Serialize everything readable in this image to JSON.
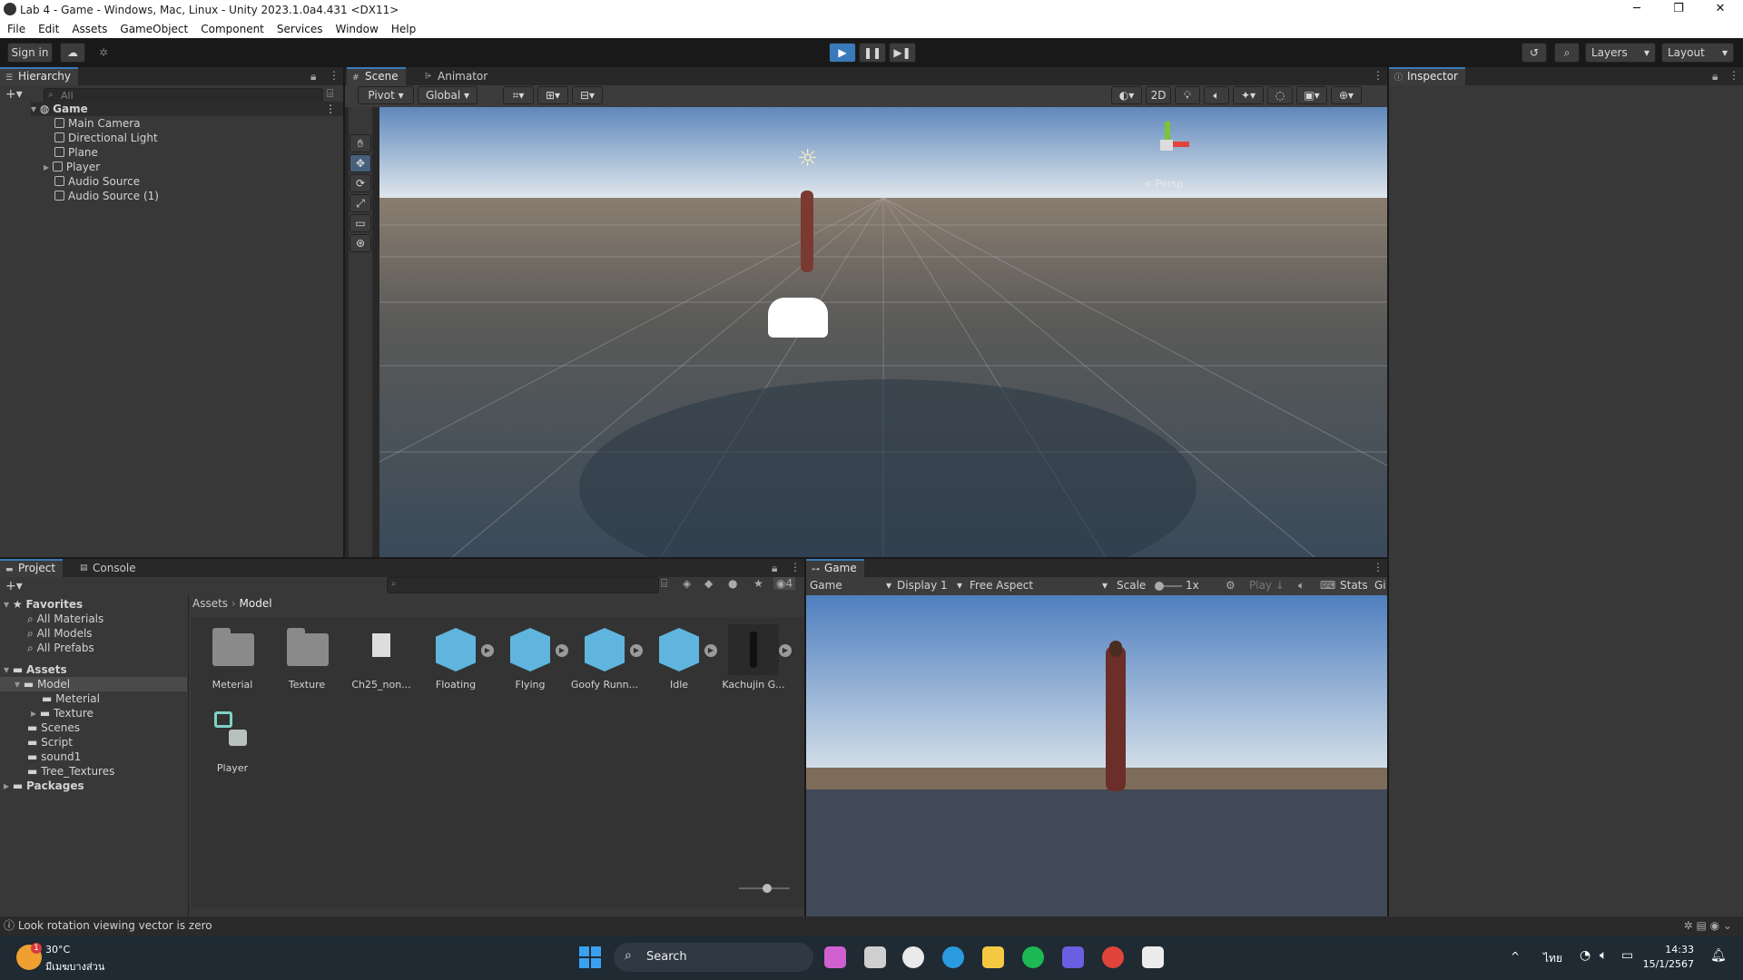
{
  "window": {
    "title": "Lab 4 - Game - Windows, Mac, Linux - Unity 2023.1.0a4.431 <DX11>",
    "controls": [
      "─",
      "❐",
      "✕"
    ]
  },
  "menu": [
    "File",
    "Edit",
    "Assets",
    "GameObject",
    "Component",
    "Services",
    "Window",
    "Help"
  ],
  "toolbar": {
    "sign_in": "Sign in",
    "layers": "Layers",
    "layout": "Layout"
  },
  "hierarchy": {
    "tab": "Hierarchy",
    "search_placeholder": "All",
    "scene": "Game",
    "items": [
      "Main Camera",
      "Directional Light",
      "Plane",
      "Player",
      "Audio Source",
      "Audio Source (1)"
    ]
  },
  "scene_view": {
    "tabs": [
      "Scene",
      "Animator"
    ],
    "pivot": "Pivot",
    "global": "Global",
    "mode_2d": "2D",
    "persp": "< Persp"
  },
  "inspector": {
    "tab": "Inspector"
  },
  "project": {
    "tabs": [
      "Project",
      "Console"
    ],
    "favorites_label": "Favorites",
    "favorites": [
      "All Materials",
      "All Models",
      "All Prefabs"
    ],
    "assets_label": "Assets",
    "tree": [
      "Model",
      "Meterial",
      "Texture",
      "Scenes",
      "Script",
      "sound1",
      "Tree_Textures"
    ],
    "packages_label": "Packages",
    "breadcrumb": [
      "Assets",
      "Model"
    ],
    "hidden_count": "4",
    "items": [
      {
        "name": "Meterial",
        "kind": "folder"
      },
      {
        "name": "Texture",
        "kind": "folder"
      },
      {
        "name": "Ch25_non...",
        "kind": "file"
      },
      {
        "name": "Floating",
        "kind": "model"
      },
      {
        "name": "Flying",
        "kind": "model"
      },
      {
        "name": "Goofy Runn...",
        "kind": "model"
      },
      {
        "name": "Idle",
        "kind": "model"
      },
      {
        "name": "Kachujin G...",
        "kind": "character"
      },
      {
        "name": "Player",
        "kind": "prefab"
      }
    ]
  },
  "game_view": {
    "tab": "Game",
    "mode": "Game",
    "display": "Display 1",
    "aspect": "Free Aspect",
    "scale_label": "Scale",
    "scale_value": "1x",
    "play_label": "Play ↓",
    "stats": "Stats",
    "gizmos": "Gi"
  },
  "status": {
    "message": "Look rotation viewing vector is zero"
  },
  "taskbar": {
    "temperature": "30°C",
    "weather_text": "มีเมฆบางส่วน",
    "search": "Search",
    "lang": "ไทย",
    "time": "14:33",
    "date": "15/1/2567",
    "notification_badge": "1"
  },
  "colors": {
    "editor_bg": "#383838",
    "accent_blue": "#3a79bb",
    "model_blue": "#5fb5dd",
    "prefab_teal": "#7ed3c5"
  }
}
